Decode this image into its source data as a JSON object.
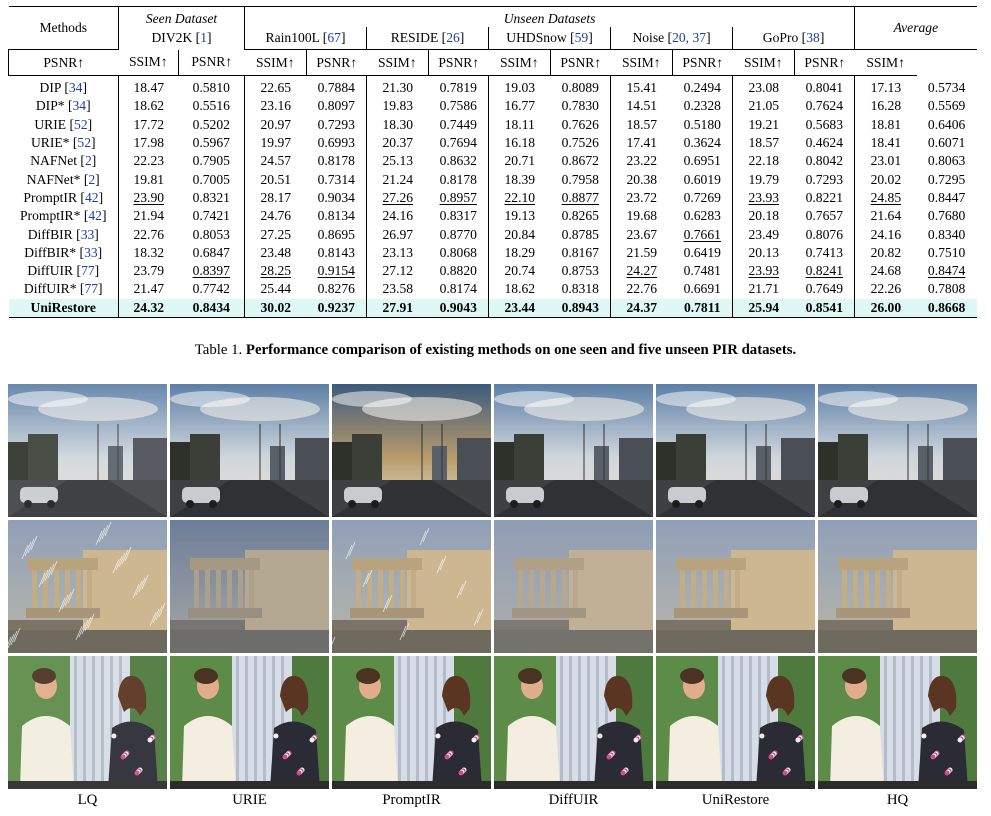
{
  "table": {
    "methods_header": "Methods",
    "seen_header": "Seen Dataset",
    "unseen_header": "Unseen Datasets",
    "average_header": "Average",
    "datasets": [
      {
        "name": "DIV2K",
        "cites": "1"
      },
      {
        "name": "Rain100L",
        "cites": "67"
      },
      {
        "name": "RESIDE",
        "cites": "26"
      },
      {
        "name": "UHDSnow",
        "cites": "59"
      },
      {
        "name": "Noise",
        "cites": "20, 37"
      },
      {
        "name": "GoPro",
        "cites": "38"
      }
    ],
    "metric_headers": [
      "PSNR↑",
      "SSIM↑"
    ],
    "rows": [
      {
        "method": "DIP",
        "cite": "34",
        "values": [
          "18.47",
          "0.5810",
          "22.65",
          "0.7884",
          "21.30",
          "0.7819",
          "19.03",
          "0.8089",
          "15.41",
          "0.2494",
          "23.08",
          "0.8041",
          "17.13",
          "0.5734"
        ],
        "underlined": []
      },
      {
        "method": "DIP*",
        "cite": "34",
        "values": [
          "18.62",
          "0.5516",
          "23.16",
          "0.8097",
          "19.83",
          "0.7586",
          "16.77",
          "0.7830",
          "14.51",
          "0.2328",
          "21.05",
          "0.7624",
          "16.28",
          "0.5569"
        ],
        "underlined": []
      },
      {
        "method": "URIE",
        "cite": "52",
        "values": [
          "17.72",
          "0.5202",
          "20.97",
          "0.7293",
          "18.30",
          "0.7449",
          "18.11",
          "0.7626",
          "18.57",
          "0.5180",
          "19.21",
          "0.5683",
          "18.81",
          "0.6406"
        ],
        "underlined": []
      },
      {
        "method": "URIE*",
        "cite": "52",
        "values": [
          "17.98",
          "0.5967",
          "19.97",
          "0.6993",
          "20.37",
          "0.7694",
          "16.18",
          "0.7526",
          "17.41",
          "0.3624",
          "18.57",
          "0.4624",
          "18.41",
          "0.6071"
        ],
        "underlined": []
      },
      {
        "method": "NAFNet",
        "cite": "2",
        "values": [
          "22.23",
          "0.7905",
          "24.57",
          "0.8178",
          "25.13",
          "0.8632",
          "20.71",
          "0.8672",
          "23.22",
          "0.6951",
          "22.18",
          "0.8042",
          "23.01",
          "0.8063"
        ],
        "underlined": []
      },
      {
        "method": "NAFNet*",
        "cite": "2",
        "values": [
          "19.81",
          "0.7005",
          "20.51",
          "0.7314",
          "21.24",
          "0.8178",
          "18.39",
          "0.7958",
          "20.38",
          "0.6019",
          "19.79",
          "0.7293",
          "20.02",
          "0.7295"
        ],
        "underlined": []
      },
      {
        "method": "PromptIR",
        "cite": "42",
        "values": [
          "23.90",
          "0.8321",
          "28.17",
          "0.9034",
          "27.26",
          "0.8957",
          "22.10",
          "0.8877",
          "23.72",
          "0.7269",
          "23.93",
          "0.8221",
          "24.85",
          "0.8447"
        ],
        "underlined": [
          0,
          4,
          5,
          6,
          7,
          10,
          12
        ]
      },
      {
        "method": "PromptIR*",
        "cite": "42",
        "values": [
          "21.94",
          "0.7421",
          "24.76",
          "0.8134",
          "24.16",
          "0.8317",
          "19.13",
          "0.8265",
          "19.68",
          "0.6283",
          "20.18",
          "0.7657",
          "21.64",
          "0.7680"
        ],
        "underlined": []
      },
      {
        "method": "DiffBIR",
        "cite": "33",
        "values": [
          "22.76",
          "0.8053",
          "27.25",
          "0.8695",
          "26.97",
          "0.8770",
          "20.84",
          "0.8785",
          "23.67",
          "0.7661",
          "23.49",
          "0.8076",
          "24.16",
          "0.8340"
        ],
        "underlined": [
          9
        ]
      },
      {
        "method": "DiffBIR*",
        "cite": "33",
        "values": [
          "18.32",
          "0.6847",
          "23.48",
          "0.8143",
          "23.13",
          "0.8068",
          "18.29",
          "0.8167",
          "21.59",
          "0.6419",
          "20.13",
          "0.7413",
          "20.82",
          "0.7510"
        ],
        "underlined": []
      },
      {
        "method": "DiffUIR",
        "cite": "77",
        "values": [
          "23.79",
          "0.8397",
          "28.25",
          "0.9154",
          "27.12",
          "0.8820",
          "20.74",
          "0.8753",
          "24.27",
          "0.7481",
          "23.93",
          "0.8241",
          "24.68",
          "0.8474"
        ],
        "underlined": [
          1,
          2,
          3,
          8,
          10,
          11,
          13
        ]
      },
      {
        "method": "DiffUIR*",
        "cite": "77",
        "values": [
          "21.47",
          "0.7742",
          "25.44",
          "0.8276",
          "23.58",
          "0.8174",
          "18.62",
          "0.8318",
          "22.76",
          "0.6691",
          "21.71",
          "0.7649",
          "22.26",
          "0.7808"
        ],
        "underlined": []
      },
      {
        "method": "UniRestore",
        "cite": "",
        "values": [
          "24.32",
          "0.8434",
          "30.02",
          "0.9237",
          "27.91",
          "0.9043",
          "23.44",
          "0.8943",
          "24.37",
          "0.7811",
          "25.94",
          "0.8541",
          "26.00",
          "0.8668"
        ],
        "underlined": []
      }
    ]
  },
  "caption": {
    "prefix": "Table 1.",
    "text": "Performance comparison of existing methods on one seen and five unseen PIR datasets."
  },
  "figure": {
    "column_labels": [
      "LQ",
      "URIE",
      "PromptIR",
      "DiffUIR",
      "UniRestore",
      "HQ"
    ],
    "rows": [
      {
        "scene": "street-sunset"
      },
      {
        "scene": "rainy-temple"
      },
      {
        "scene": "couple-portrait"
      }
    ]
  }
}
